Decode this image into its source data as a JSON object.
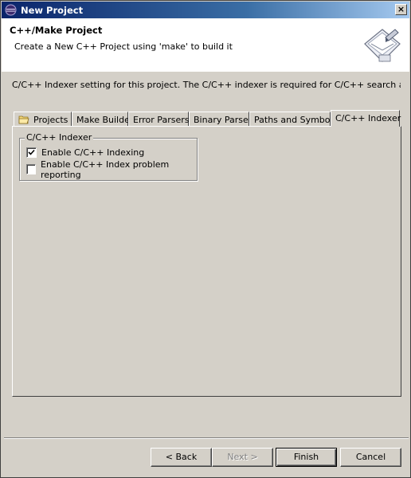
{
  "window": {
    "title": "New Project",
    "close_label": "×"
  },
  "header": {
    "title": "C++/Make Project",
    "description": "Create a New C++ Project using 'make' to build it"
  },
  "intro_text": "C/C++ Indexer setting for this project. The C/C++ indexer is required for C/C++ search and other re",
  "tabs": [
    {
      "label": "Projects"
    },
    {
      "label": "Make Builder"
    },
    {
      "label": "Error Parsers"
    },
    {
      "label": "Binary Parser"
    },
    {
      "label": "Paths and Symbols"
    },
    {
      "label": "C/C++ Indexer",
      "active": true
    }
  ],
  "indexer_group": {
    "legend": "C/C++ Indexer",
    "options": [
      {
        "label": "Enable C/C++ Indexing",
        "checked": true
      },
      {
        "label": "Enable C/C++ Index problem reporting",
        "checked": false
      }
    ]
  },
  "buttons": {
    "back": "< Back",
    "next": "Next >",
    "finish": "Finish",
    "cancel": "Cancel"
  }
}
